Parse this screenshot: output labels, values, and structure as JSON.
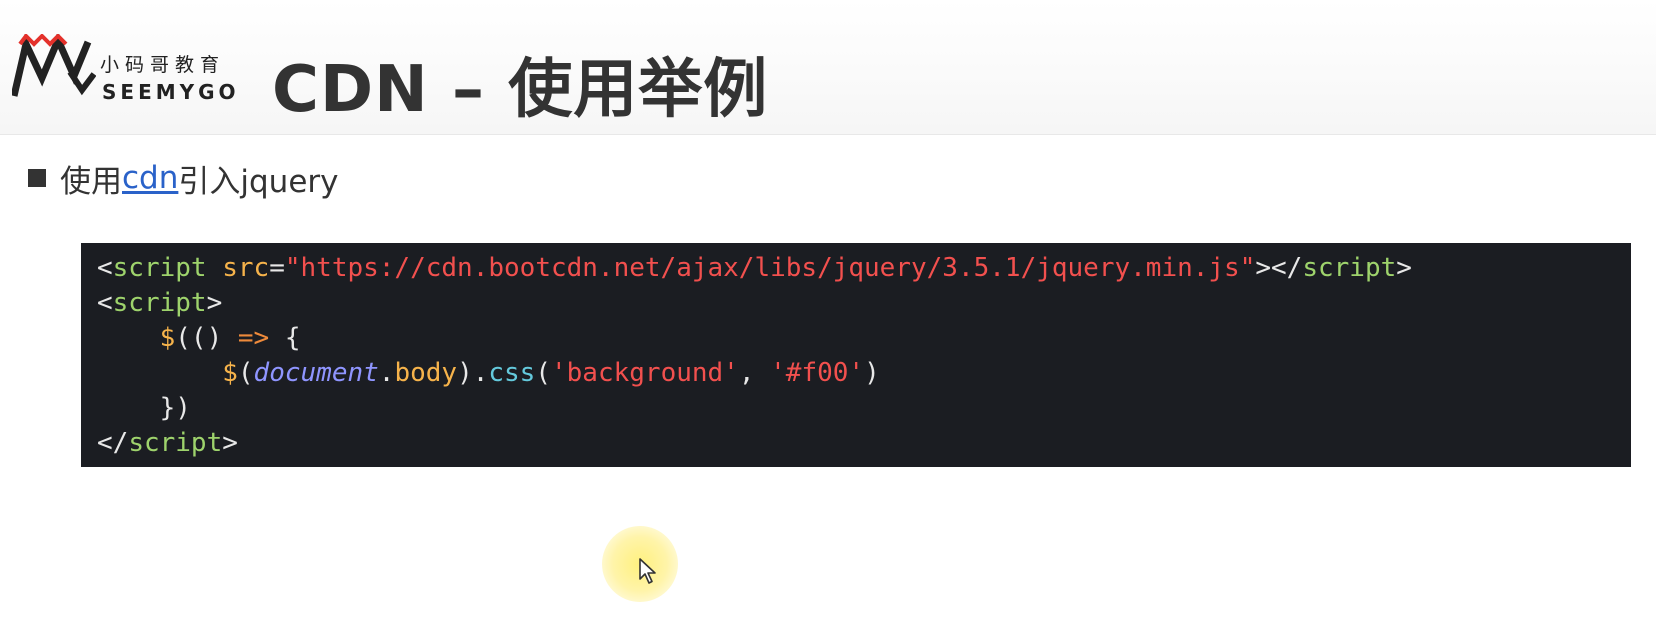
{
  "logo": {
    "chinese_text": "小码哥教育",
    "english_text": "SEEMYGO"
  },
  "slide": {
    "title": "CDN – 使用举例"
  },
  "bullet": {
    "prefix": "使用",
    "link_text": "cdn",
    "suffix": "引入jquery"
  },
  "code": {
    "line1": {
      "open_bracket": "<",
      "tag": "script",
      "attr": " src",
      "equals": "=",
      "url": "\"https://cdn.bootcdn.net/ajax/libs/jquery/3.5.1/jquery.min.js\"",
      "close_open": "></",
      "tag_close": "script",
      "end": ">"
    },
    "line2": {
      "open_bracket": "<",
      "tag": "script",
      "end": ">"
    },
    "line3": {
      "indent": "    ",
      "dollar": "$",
      "parens": "(() ",
      "arrow": "=>",
      "brace": " {"
    },
    "line4": {
      "indent": "        ",
      "dollar": "$",
      "open": "(",
      "document": "document",
      "dot1": ".",
      "body": "body",
      "close_dot": ").",
      "css": "css",
      "args_open": "(",
      "arg1": "'background'",
      "comma": ", ",
      "arg2": "'#f00'",
      "args_close": ")"
    },
    "line5": {
      "indent": "    ",
      "text": "})"
    },
    "line6": {
      "open": "</",
      "tag": "script",
      "end": ">"
    }
  },
  "colors": {
    "code_background": "#1b1d22",
    "tag": "#9ed36c",
    "attribute": "#f6b34b",
    "string": "#f2504e",
    "link": "#2a62c9",
    "cursor_highlight": "#fff07a"
  },
  "icons": {
    "logo": "seemygo-logo-icon",
    "cursor": "mouse-pointer-icon"
  }
}
